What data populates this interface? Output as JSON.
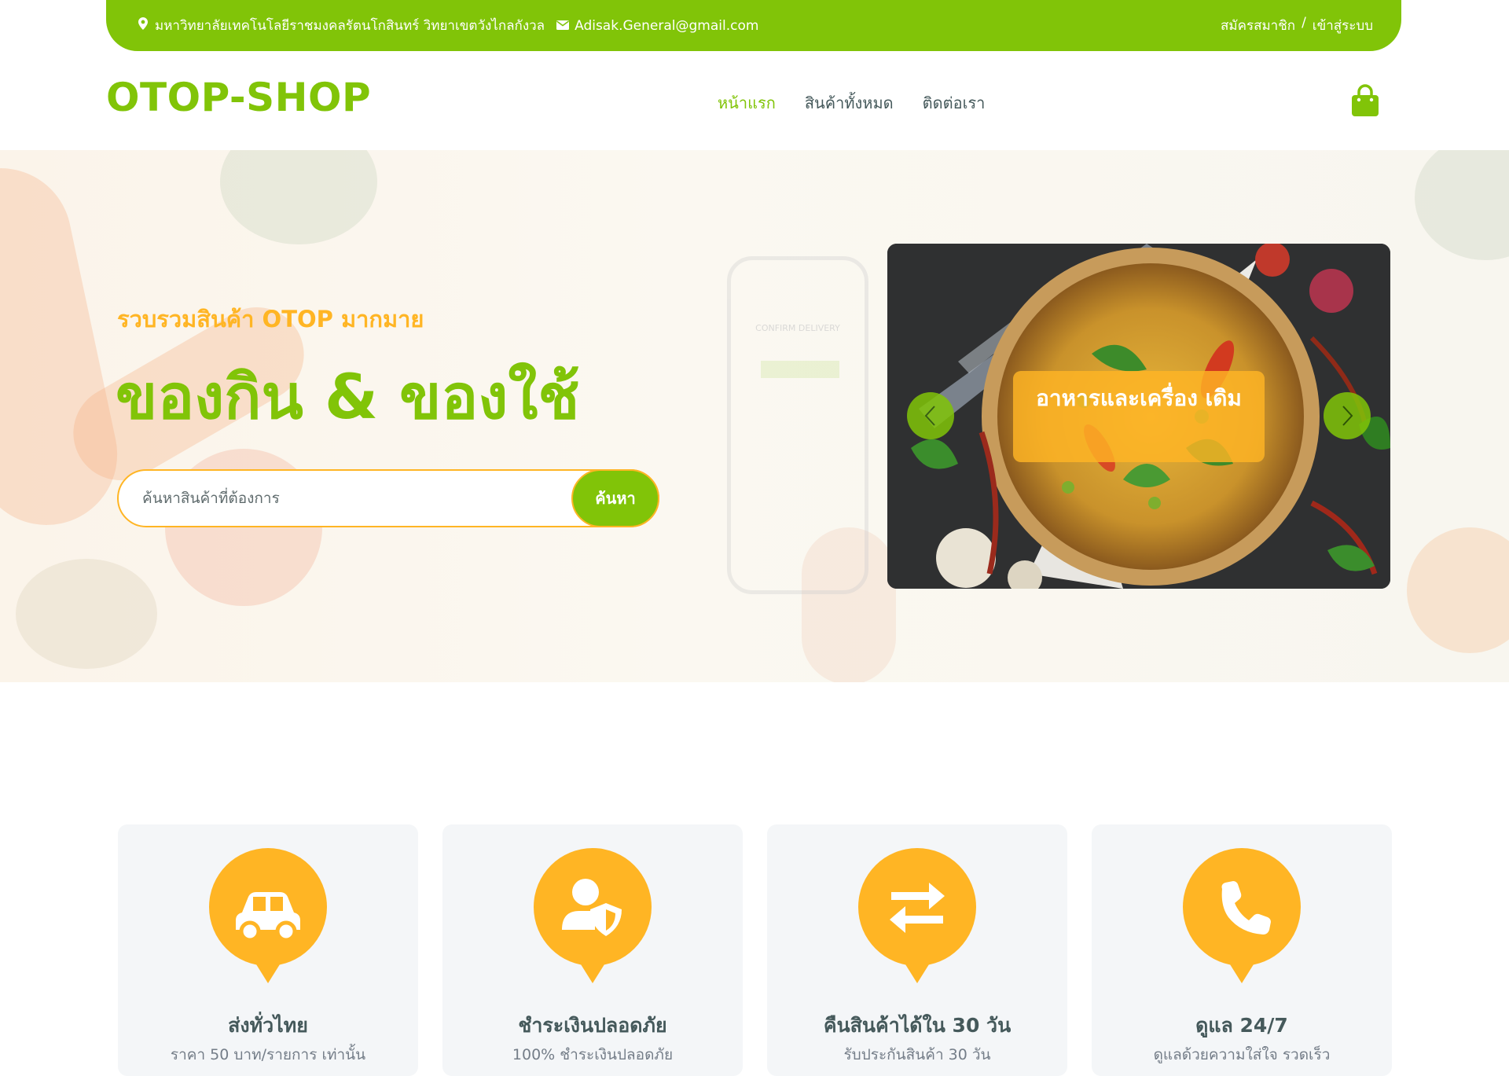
{
  "topbar": {
    "address": "มหาวิทยาลัยเทคโนโลยีราชมงคลรัตนโกสินทร์ วิทยาเขตวังไกลกังวล",
    "email": "Adisak.General@gmail.com",
    "register": "สมัครสมาชิก",
    "separator": "/",
    "login": "เข้าสู่ระบบ"
  },
  "navbar": {
    "logo": "OTOP-SHOP",
    "menu": [
      {
        "label": "หน้าแรก",
        "active": true
      },
      {
        "label": "สินค้าทั้งหมด",
        "active": false
      },
      {
        "label": "ติดต่อเรา",
        "active": false
      }
    ]
  },
  "hero": {
    "subtitle": "รวบรวมสินค้า OTOP มากมาย",
    "title": "ของกิน & ของใช้",
    "search": {
      "placeholder": "ค้นหาสินค้าที่ต้องการ",
      "button": "ค้นหา"
    },
    "phone_text": "CONFIRM DELIVERY",
    "carousel": {
      "slide_label": "อาหารและเครื่อง เดิม"
    }
  },
  "features": [
    {
      "icon": "car-icon",
      "title": "ส่งทั่วไทย",
      "desc": "ราคา 50 บาท/รายการ เท่านั้น"
    },
    {
      "icon": "user-shield-icon",
      "title": "ชำระเงินปลอดภัย",
      "desc": "100% ชำระเงินปลอดภัย"
    },
    {
      "icon": "exchange-icon",
      "title": "คืนสินค้าได้ใน 30 วัน",
      "desc": "รับประกันสินค้า 30 วัน"
    },
    {
      "icon": "phone-icon",
      "title": "ดูแล 24/7",
      "desc": "ดูแลด้วยความใส่ใจ รวดเร็ว"
    }
  ],
  "colors": {
    "primary": "#81c408",
    "secondary": "#ffb524",
    "text_dark": "#45595b",
    "card_bg": "#f4f6f8"
  }
}
